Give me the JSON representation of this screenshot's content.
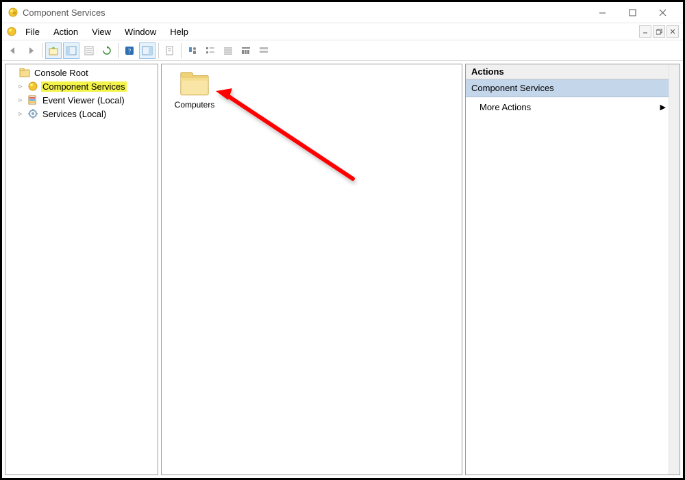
{
  "title": "Component Services",
  "menu": {
    "file": "File",
    "action": "Action",
    "view": "View",
    "window": "Window",
    "help": "Help"
  },
  "tree": {
    "root": {
      "label": "Console Root",
      "icon": "console-root-icon"
    },
    "items": [
      {
        "label": "Component Services",
        "icon": "component-services-icon",
        "highlighted": true
      },
      {
        "label": "Event Viewer (Local)",
        "icon": "event-viewer-icon",
        "highlighted": false
      },
      {
        "label": "Services (Local)",
        "icon": "services-icon",
        "highlighted": false
      }
    ]
  },
  "content": {
    "items": [
      {
        "label": "Computers",
        "icon": "folder-icon"
      }
    ]
  },
  "actions": {
    "header": "Actions",
    "section": "Component Services",
    "rows": [
      {
        "label": "More Actions",
        "has_submenu": true
      }
    ]
  },
  "toolbar": {
    "buttons": [
      "back-icon",
      "forward-icon",
      "sep",
      "up-folder-icon",
      "show-hide-tree-icon",
      "export-list-icon",
      "refresh-icon",
      "sep",
      "help-icon",
      "show-hide-action-icon",
      "sep",
      "properties-icon",
      "sep",
      "app-status-icon",
      "app-status2-icon",
      "app-status3-icon",
      "dcom-config-icon",
      "dcom-config2-icon"
    ]
  }
}
